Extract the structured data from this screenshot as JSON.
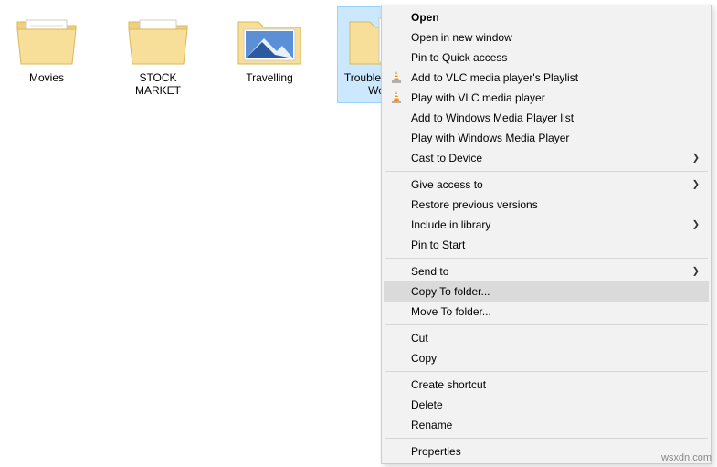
{
  "folders": [
    {
      "label": "Movies",
      "variant": "full"
    },
    {
      "label": "STOCK MARKET",
      "variant": "full-paper"
    },
    {
      "label": "Travelling",
      "variant": "picture"
    },
    {
      "label": "Troubleshooter Work",
      "variant": "doc"
    }
  ],
  "selected_index": 3,
  "context_menu": {
    "groups": [
      [
        {
          "label": "Open",
          "bold": true
        },
        {
          "label": "Open in new window"
        },
        {
          "label": "Pin to Quick access"
        },
        {
          "label": "Add to VLC media player's Playlist",
          "icon": "vlc"
        },
        {
          "label": "Play with VLC media player",
          "icon": "vlc"
        },
        {
          "label": "Add to Windows Media Player list"
        },
        {
          "label": "Play with Windows Media Player"
        },
        {
          "label": "Cast to Device",
          "submenu": true
        }
      ],
      [
        {
          "label": "Give access to",
          "submenu": true
        },
        {
          "label": "Restore previous versions"
        },
        {
          "label": "Include in library",
          "submenu": true
        },
        {
          "label": "Pin to Start"
        }
      ],
      [
        {
          "label": "Send to",
          "submenu": true
        },
        {
          "label": "Copy To folder...",
          "hover": true
        },
        {
          "label": "Move To folder..."
        }
      ],
      [
        {
          "label": "Cut"
        },
        {
          "label": "Copy"
        }
      ],
      [
        {
          "label": "Create shortcut"
        },
        {
          "label": "Delete"
        },
        {
          "label": "Rename"
        }
      ],
      [
        {
          "label": "Properties"
        }
      ]
    ]
  },
  "watermark": "wsxdn.com"
}
